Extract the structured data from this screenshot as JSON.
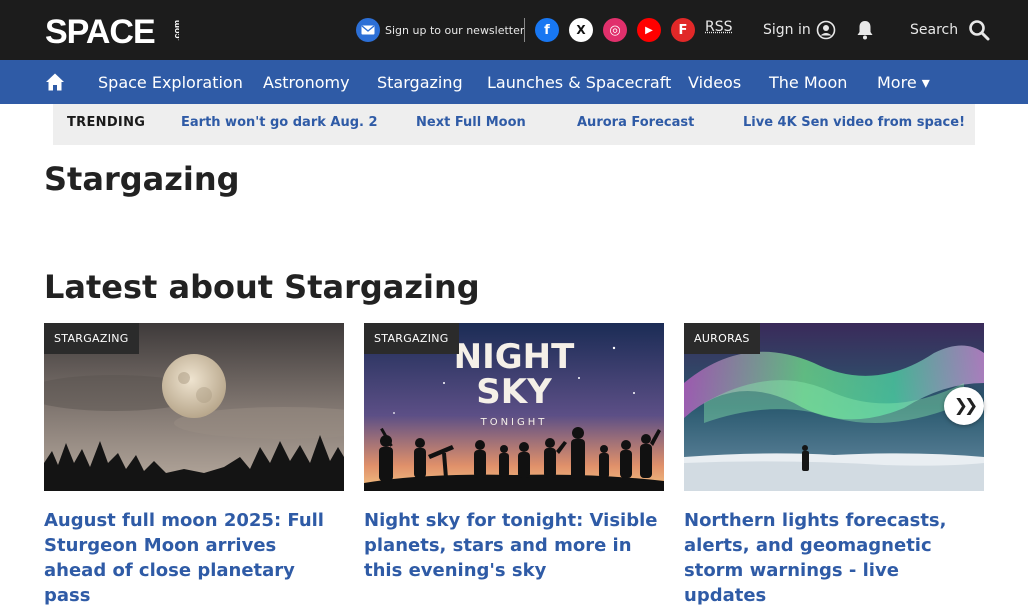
{
  "header": {
    "logo_text": "SPACE",
    "logo_suffix": ".com",
    "newsletter_label": "Sign up to our newsletter",
    "rss_label": "RSS",
    "signin_label": "Sign in",
    "search_label": "Search",
    "social": [
      {
        "name": "facebook-icon",
        "glyph": "f",
        "color": "#1877f2"
      },
      {
        "name": "x-twitter-icon",
        "glyph": "X",
        "color": "#ffffff"
      },
      {
        "name": "instagram-icon",
        "glyph": "◎",
        "color": "#e1306c"
      },
      {
        "name": "youtube-icon",
        "glyph": "▶",
        "color": "#ff0000"
      },
      {
        "name": "flipboard-icon",
        "glyph": "F",
        "color": "#e12828"
      }
    ]
  },
  "nav": {
    "items": [
      "Space Exploration",
      "Astronomy",
      "Stargazing",
      "Launches & Spacecraft",
      "Videos",
      "The Moon",
      "More ▾"
    ]
  },
  "trending": {
    "label": "TRENDING",
    "links": [
      "Earth won't go dark Aug. 2",
      "Next Full Moon",
      "Aurora Forecast",
      "Live 4K Sen video from space!"
    ]
  },
  "page": {
    "title": "Stargazing",
    "section_title": "Latest about Stargazing"
  },
  "cards": [
    {
      "tag": "STARGAZING",
      "headline": "August full moon 2025: Full Sturgeon Moon arrives ahead of close planetary pass"
    },
    {
      "tag": "STARGAZING",
      "headline": "Night sky for tonight: Visible planets, stars and more in this evening's sky",
      "image_text_1": "NIGHT",
      "image_text_2": "SKY",
      "image_text_3": "TONIGHT"
    },
    {
      "tag": "AURORAS",
      "headline": "Northern lights forecasts, alerts, and geomagnetic storm warnings - live updates"
    }
  ],
  "carousel": {
    "next_glyph": "❯❯"
  },
  "colors": {
    "topbar": "#1c1c1c",
    "nav": "#2f5ba6",
    "link": "#2f5ba6",
    "trending_bg": "#eeeeee"
  }
}
